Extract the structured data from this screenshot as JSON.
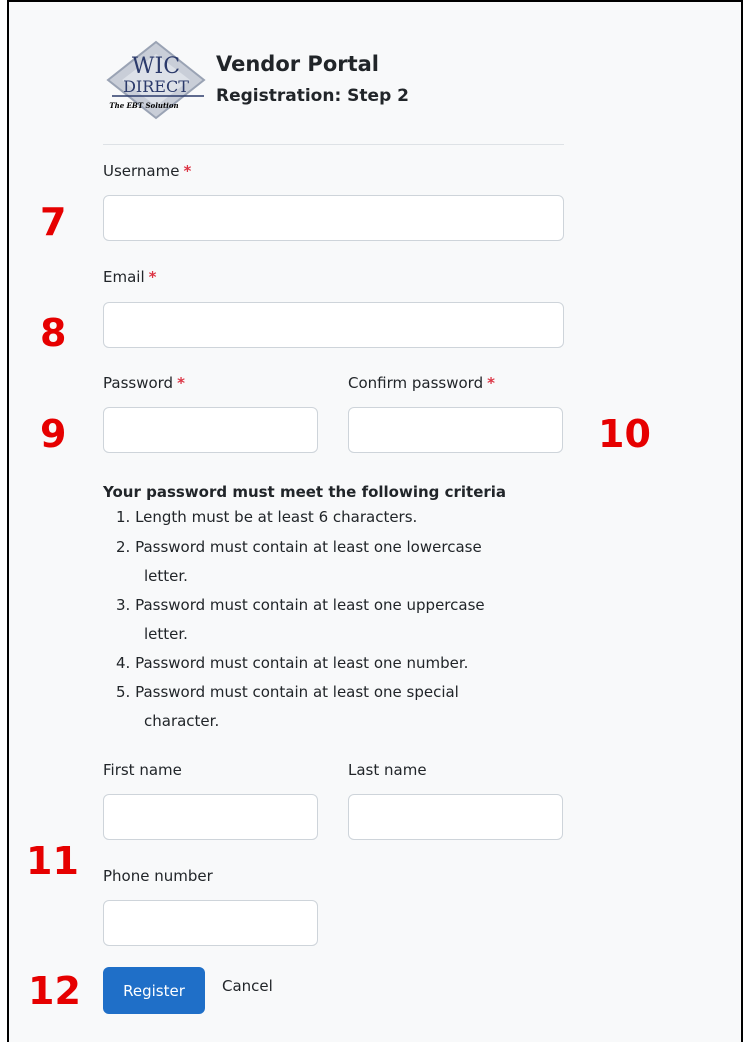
{
  "header": {
    "logo_text": "WIC DIRECT The EBT Solution",
    "title": "Vendor Portal",
    "subtitle": "Registration: Step 2"
  },
  "form": {
    "username": {
      "label": "Username",
      "required_mark": "*",
      "value": ""
    },
    "email": {
      "label": "Email",
      "required_mark": "*",
      "value": ""
    },
    "password": {
      "label": "Password",
      "required_mark": "*",
      "value": ""
    },
    "confirm_password": {
      "label": "Confirm password",
      "required_mark": "*",
      "value": ""
    },
    "first_name": {
      "label": "First name",
      "value": ""
    },
    "last_name": {
      "label": "Last name",
      "value": ""
    },
    "phone": {
      "label": "Phone number",
      "value": ""
    }
  },
  "criteria": {
    "title": "Your password must meet the following criteria",
    "items": [
      "1. Length must be at least 6 characters.",
      "2. Password must contain at least one lowercase",
      "letter.",
      "3. Password must contain at least one uppercase",
      "letter.",
      "4. Password must contain at least one number.",
      "5. Password must contain at least one special",
      "character."
    ]
  },
  "actions": {
    "register_label": "Register",
    "cancel_label": "Cancel"
  },
  "annotations": [
    "7",
    "8",
    "9",
    "10",
    "11",
    "12"
  ],
  "colors": {
    "annotation": "#e60000",
    "primary": "#1f6fc8",
    "required": "#dc3545"
  }
}
